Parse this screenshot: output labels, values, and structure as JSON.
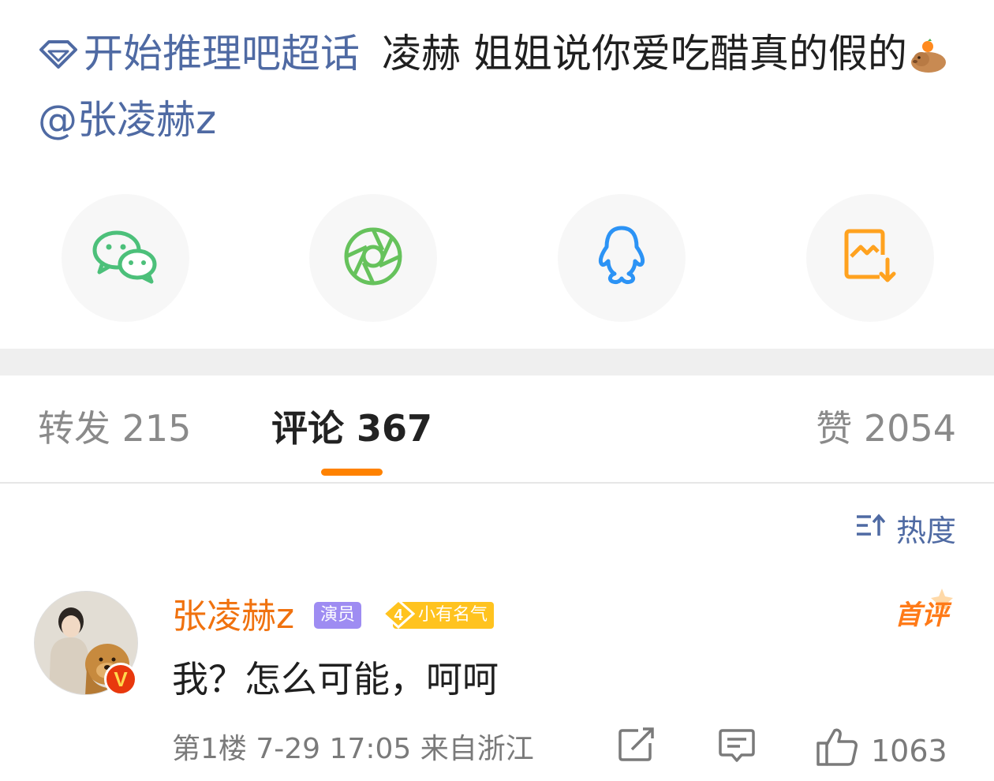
{
  "post": {
    "topic": "开始推理吧超话",
    "text": "凌赫 姐姐说你爱吃醋真的假的",
    "mention": "@张凌赫z",
    "emoji_icon": "capybara-orange-emoji"
  },
  "share": {
    "items": [
      {
        "name": "wechat",
        "icon": "wechat-icon",
        "color": "#4cc07a"
      },
      {
        "name": "moments",
        "icon": "wechat-moments-icon",
        "color": "#66c25c"
      },
      {
        "name": "qq",
        "icon": "qq-penguin-icon",
        "color": "#2c93f5"
      },
      {
        "name": "save-image",
        "icon": "save-image-icon",
        "color": "#ffa21f"
      }
    ]
  },
  "tabs": {
    "repost": "转发 215",
    "comments": "评论 367",
    "likes": "赞 2054",
    "active": "comments",
    "accent": "#ff8200"
  },
  "sort": {
    "icon": "sort-icon",
    "label": "热度"
  },
  "comment": {
    "username": "张凌赫z",
    "role_badge": "演员",
    "level_number": "4",
    "level_label": "小有名气",
    "first_tag": "首评",
    "text": "我？怎么可能，呵呵",
    "floor": "第1楼",
    "time": "7-29 17:05",
    "location": "来自浙江",
    "like_count": "1063",
    "verified_icon": "verified-v-icon"
  }
}
